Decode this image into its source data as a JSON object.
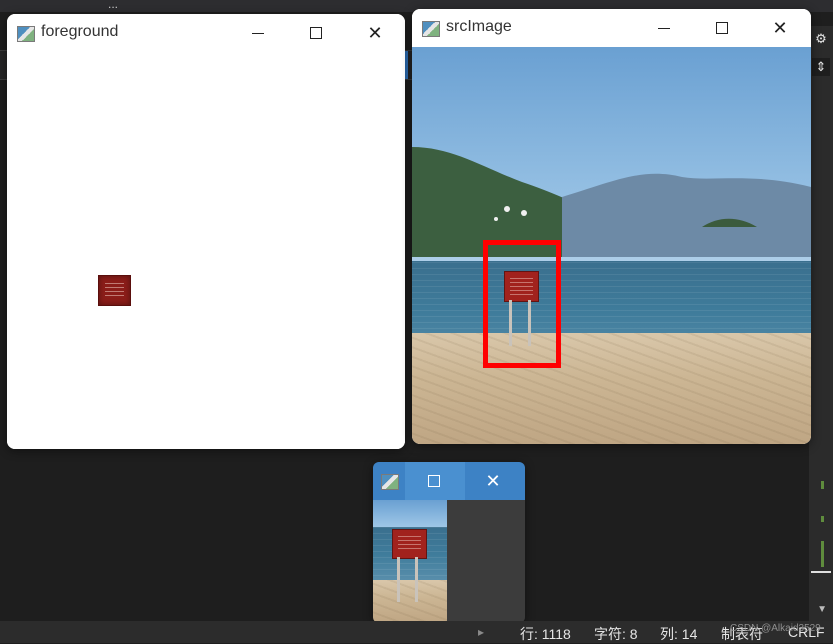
{
  "ide": {
    "partial_top_text": "...",
    "statusbar": {
      "line": "行: 1118",
      "chars": "字符: 8",
      "col": "列: 14",
      "tab": "制表符",
      "eol": "CRLF"
    },
    "watermark": "CSDN @Alkaid3529"
  },
  "windows": {
    "foreground": {
      "title": "foreground"
    },
    "srcImage": {
      "title": "srcImage"
    },
    "mini": {
      "title": ""
    }
  },
  "icons": {
    "window_icon": "window-app-icon",
    "minimize": "minimize-icon",
    "maximize": "maximize-icon",
    "close": "close-icon",
    "rail_settings": "gear-icon",
    "rail_split": "split-vertical-icon"
  },
  "colors": {
    "selection_rect": "#ff0000",
    "ide_background": "#1e1e1e",
    "mini_titlebar": "#3d82c5"
  }
}
